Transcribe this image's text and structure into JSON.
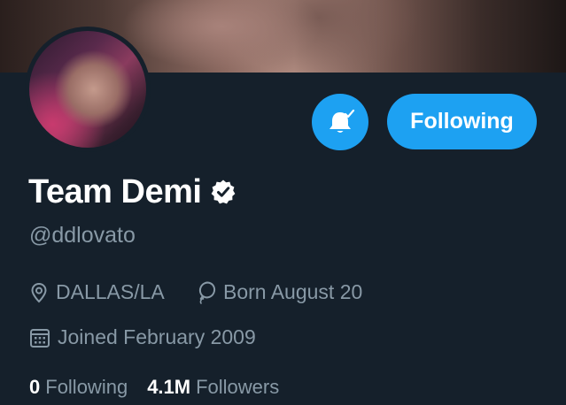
{
  "profile": {
    "display_name": "Team Demi",
    "handle": "@ddlovato",
    "verified": true,
    "location": "DALLAS/LA",
    "birthday": "Born August 20",
    "joined": "Joined February 2009"
  },
  "actions": {
    "following_label": "Following",
    "notifications_icon": "bell-check-icon"
  },
  "stats": {
    "following_count": "0",
    "following_label": "Following",
    "followers_count": "4.1M",
    "followers_label": "Followers"
  },
  "colors": {
    "background": "#15202b",
    "accent": "#1da1f2",
    "secondary_text": "#8899a6",
    "primary_text": "#ffffff"
  }
}
